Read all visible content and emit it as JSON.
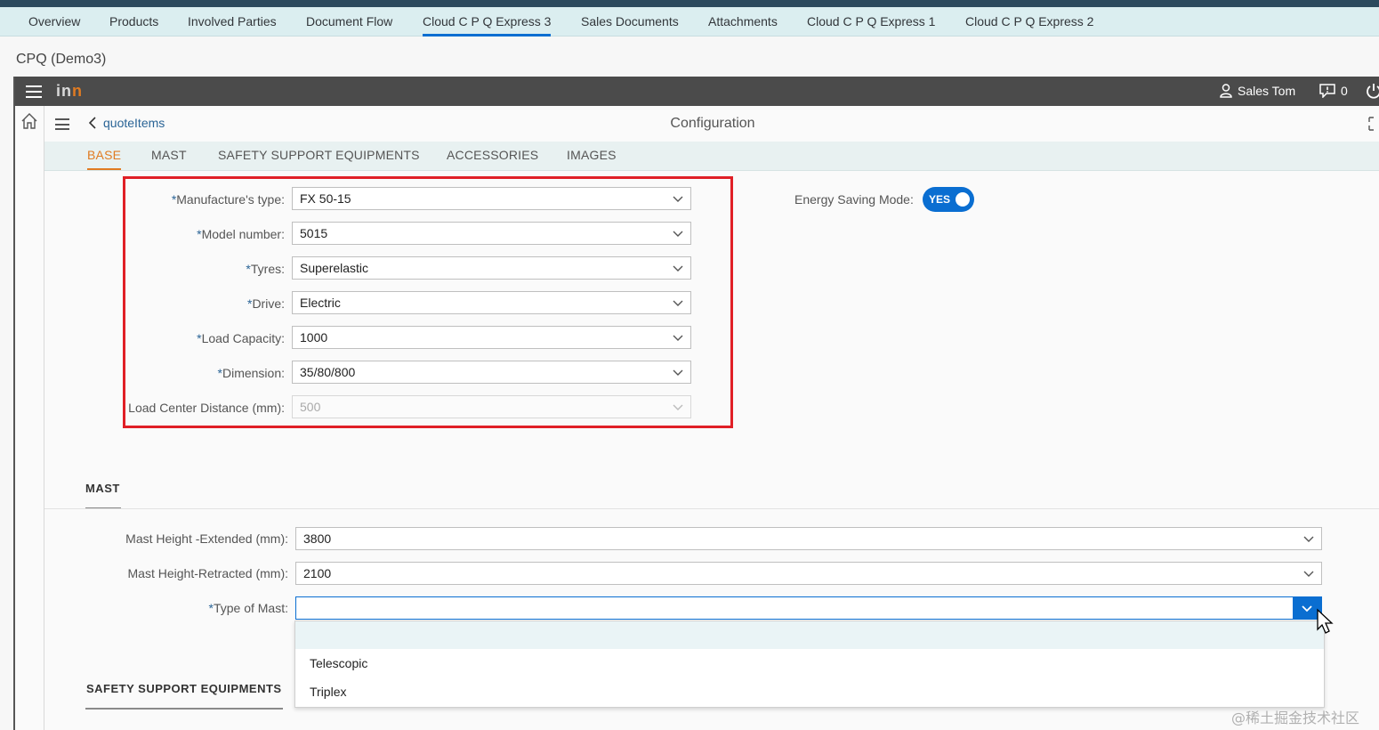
{
  "object_tabs": [
    {
      "label": "Overview"
    },
    {
      "label": "Products"
    },
    {
      "label": "Involved Parties"
    },
    {
      "label": "Document Flow"
    },
    {
      "label": "Cloud C P Q Express 3",
      "active": true
    },
    {
      "label": "Sales Documents"
    },
    {
      "label": "Attachments"
    },
    {
      "label": "Cloud C P Q Express 1"
    },
    {
      "label": "Cloud C P Q Express 2"
    }
  ],
  "page_title": "CPQ (Demo3)",
  "header": {
    "logo_text": "in",
    "logo_accent": "n",
    "user_name": "Sales Tom",
    "notification_count": "0"
  },
  "subheader": {
    "back_label": "quoteItems",
    "title": "Configuration"
  },
  "section_tabs": [
    {
      "label": "BASE",
      "active": true
    },
    {
      "label": "MAST"
    },
    {
      "label": "SAFETY SUPPORT EQUIPMENTS"
    },
    {
      "label": "ACCESSORIES"
    },
    {
      "label": "IMAGES"
    }
  ],
  "base_fields": [
    {
      "required": "*",
      "label": "Manufacture's type:",
      "value": "FX 50-15"
    },
    {
      "required": "*",
      "label": "Model number:",
      "value": "5015"
    },
    {
      "required": "*",
      "label": "Tyres:",
      "value": "Superelastic"
    },
    {
      "required": "*",
      "label": "Drive:",
      "value": "Electric"
    },
    {
      "required": "*",
      "label": "Load Capacity:",
      "value": "1000"
    },
    {
      "required": "*",
      "label": "Dimension:",
      "value": "35/80/800"
    },
    {
      "required": "",
      "label": "Load Center Distance (mm):",
      "value": "500",
      "disabled": true
    }
  ],
  "energy": {
    "label": "Energy Saving Mode:",
    "toggle_text": "YES"
  },
  "mast_section": {
    "heading": "MAST",
    "fields": [
      {
        "required": "",
        "label": "Mast Height -Extended (mm):",
        "value": "3800"
      },
      {
        "required": "",
        "label": "Mast Height-Retracted (mm):",
        "value": "2100"
      },
      {
        "required": "*",
        "label": "Type of Mast:",
        "value": ""
      }
    ],
    "dropdown_options": [
      "Telescopic",
      "Triplex"
    ]
  },
  "safety_section": {
    "heading": "SAFETY SUPPORT EQUIPMENTS"
  },
  "watermark": "@稀土掘金技术社区",
  "colors": {
    "accent": "#0a6ed1",
    "active_tab": "#e07b22",
    "highlight": "#e01f26",
    "header_bg": "#4b4b4b"
  }
}
